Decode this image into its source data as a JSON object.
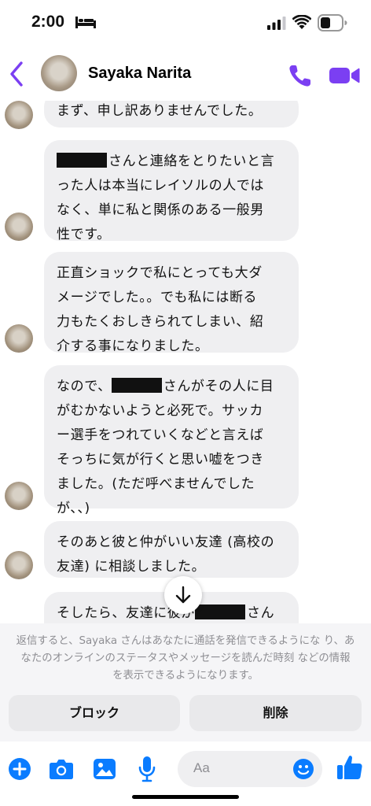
{
  "status_bar": {
    "time": "2:00"
  },
  "header": {
    "contact_name": "Sayaka Narita"
  },
  "messages": [
    {
      "text": "まず、申し訳ありませんでした。"
    },
    {
      "prefix": "",
      "text": "さんと連絡をとりたいと言\nった人は本当にレイソルの人では\nなく、単に私と関係のある一般男\n性です。"
    },
    {
      "text": "正直ショックで私にとっても大ダ\nメージでした。。でも私には断る\n力もたくおしきられてしまい、紹\n介する事になりました。"
    },
    {
      "prefix": "なので、",
      "text": "さんがその人に目\nがむかないようと必死で。サッカ\nー選手をつれていくなどと言えば\nそっちに気が行くと思い嘘をつき\nました。(ただ呼べませんでした\nが、、)"
    },
    {
      "text": "そのあと彼と仲がいい友達 (高校の\n友達) に相談しました。"
    },
    {
      "prefix": "そしたら、友達に彼が",
      "text": "さん"
    }
  ],
  "notice": {
    "text": "返信すると、Sayaka さんはあなたに通話を発信できるようにな り、あなたのオンラインのステータスやメッセージを読んだ時刻 などの情報を表示できるようになります。",
    "block_label": "ブロック",
    "delete_label": "削除"
  },
  "composer": {
    "placeholder": "Aa"
  },
  "colors": {
    "accent": "#7b3ff2",
    "blue": "#0a7cff",
    "bubble": "#efeff1"
  }
}
